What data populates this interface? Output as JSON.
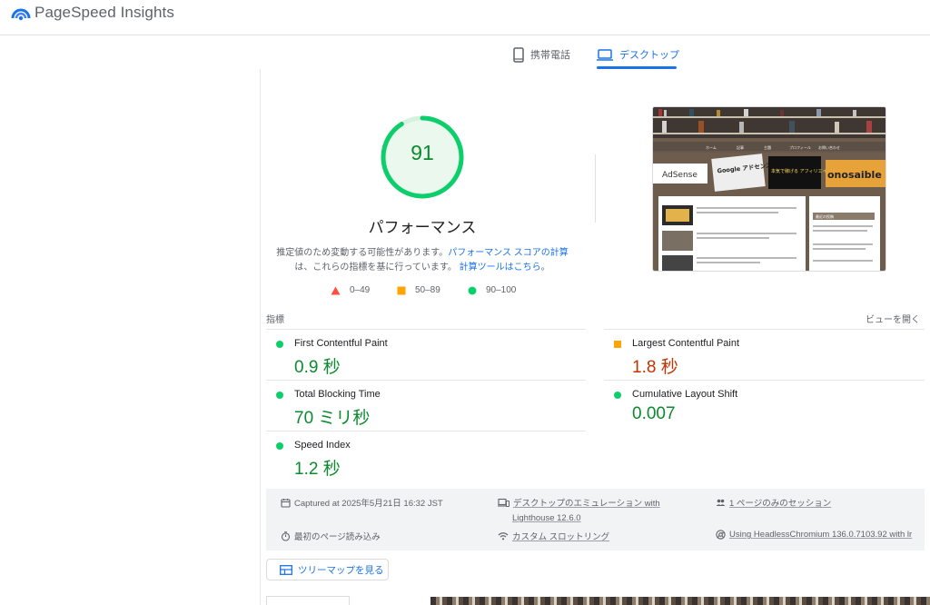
{
  "app": {
    "title": "PageSpeed Insights"
  },
  "tabs": [
    {
      "label": "携帯電話",
      "icon": "phone-icon",
      "selected": false
    },
    {
      "label": "デスクトップ",
      "icon": "laptop-icon",
      "selected": true
    }
  ],
  "score": {
    "value": "91",
    "percent": 91,
    "category": "パフォーマンス",
    "description_line1_text": "推定値のため変動する可能性があります。",
    "description_line1_link": "パフォーマンス スコアの計算",
    "description_line2_text": "は、これらの指標を基に行っています。",
    "description_line2_link": "計算ツールはこちら",
    "description_line2_end": "。"
  },
  "legend": [
    {
      "label": "0–49",
      "icon": "triangle-fail-icon"
    },
    {
      "label": "50–89",
      "icon": "square-average-icon"
    },
    {
      "label": "90–100",
      "icon": "circle-pass-icon"
    }
  ],
  "metrics": {
    "section_label": "指標",
    "expand_label": "ビューを開く",
    "items": [
      {
        "name": "First Contentful Paint",
        "value": "0.9 秒",
        "rating": "pass"
      },
      {
        "name": "Largest Contentful Paint",
        "value": "1.8 秒",
        "rating": "average"
      },
      {
        "name": "Total Blocking Time",
        "value": "70 ミリ秒",
        "rating": "pass"
      },
      {
        "name": "Cumulative Layout Shift",
        "value": "0.007",
        "rating": "pass"
      },
      {
        "name": "Speed Index",
        "value": "1.2 秒",
        "rating": "pass"
      }
    ]
  },
  "runtime": {
    "captured": "Captured at 2025年5月21日 16:32 JST",
    "emulation_line1": "デスクトップのエミュレーション with",
    "emulation_line2": "Lighthouse 12.6.0",
    "session": "1 ページのみのセッション",
    "initial_load": "最初のページ読み込み",
    "throttling": "カスタム スロットリング",
    "browser": "Using HeadlessChromium 136.0.7103.92 with lr"
  },
  "treemap_label": "ツリーマップを見る",
  "thumbnail": {
    "nav_items": [
      "ホーム",
      "記事",
      "主題",
      "プロフィール",
      "お問い合わせ"
    ],
    "books": [
      "AdSense",
      "Google アドセンス",
      "本気で稼げる アフィリエイト ブログ",
      "onosaible"
    ],
    "sidebar_title": "最近の投稿"
  },
  "colors": {
    "pass": "#0cce6b",
    "pass_text": "#0c8a2e",
    "average": "#ffa400",
    "average_text": "#c33300",
    "fail": "#ff4e42",
    "accent": "#1a73e8"
  }
}
